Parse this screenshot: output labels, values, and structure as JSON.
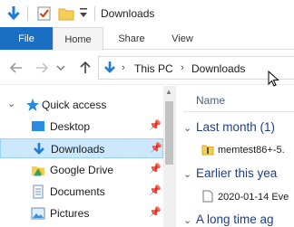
{
  "window": {
    "title": "Downloads"
  },
  "quick_access_toolbar": {
    "icons": [
      "down-arrow-icon",
      "properties-icon",
      "new-folder-icon",
      "customize-dropdown-icon"
    ]
  },
  "ribbon": {
    "tabs": [
      {
        "label": "File",
        "active": false
      },
      {
        "label": "Home",
        "active": true
      },
      {
        "label": "Share",
        "active": false
      },
      {
        "label": "View",
        "active": false
      }
    ]
  },
  "address_bar": {
    "crumbs": [
      "This PC",
      "Downloads"
    ]
  },
  "nav_pane": {
    "quick_access_label": "Quick access",
    "items": [
      {
        "label": "Desktop",
        "icon": "desktop-icon",
        "pinned": true,
        "selected": false
      },
      {
        "label": "Downloads",
        "icon": "downloads-icon",
        "pinned": true,
        "selected": true
      },
      {
        "label": "Google Drive",
        "icon": "google-drive-icon",
        "pinned": true,
        "selected": false
      },
      {
        "label": "Documents",
        "icon": "documents-icon",
        "pinned": true,
        "selected": false
      },
      {
        "label": "Pictures",
        "icon": "pictures-icon",
        "pinned": true,
        "selected": false
      }
    ]
  },
  "content": {
    "column_header": "Name",
    "groups": [
      {
        "label": "Last month (1)",
        "files": [
          "memtest86+-5."
        ]
      },
      {
        "label": "Earlier this yea",
        "files": [
          "2020-01-14 Eve"
        ]
      },
      {
        "label": "A long time ag",
        "files": []
      }
    ]
  },
  "colors": {
    "file_tab": "#1a6fc4",
    "selection": "#cce8ff",
    "group_heading": "#1e3f85",
    "accent_blue": "#1e7bd6"
  }
}
